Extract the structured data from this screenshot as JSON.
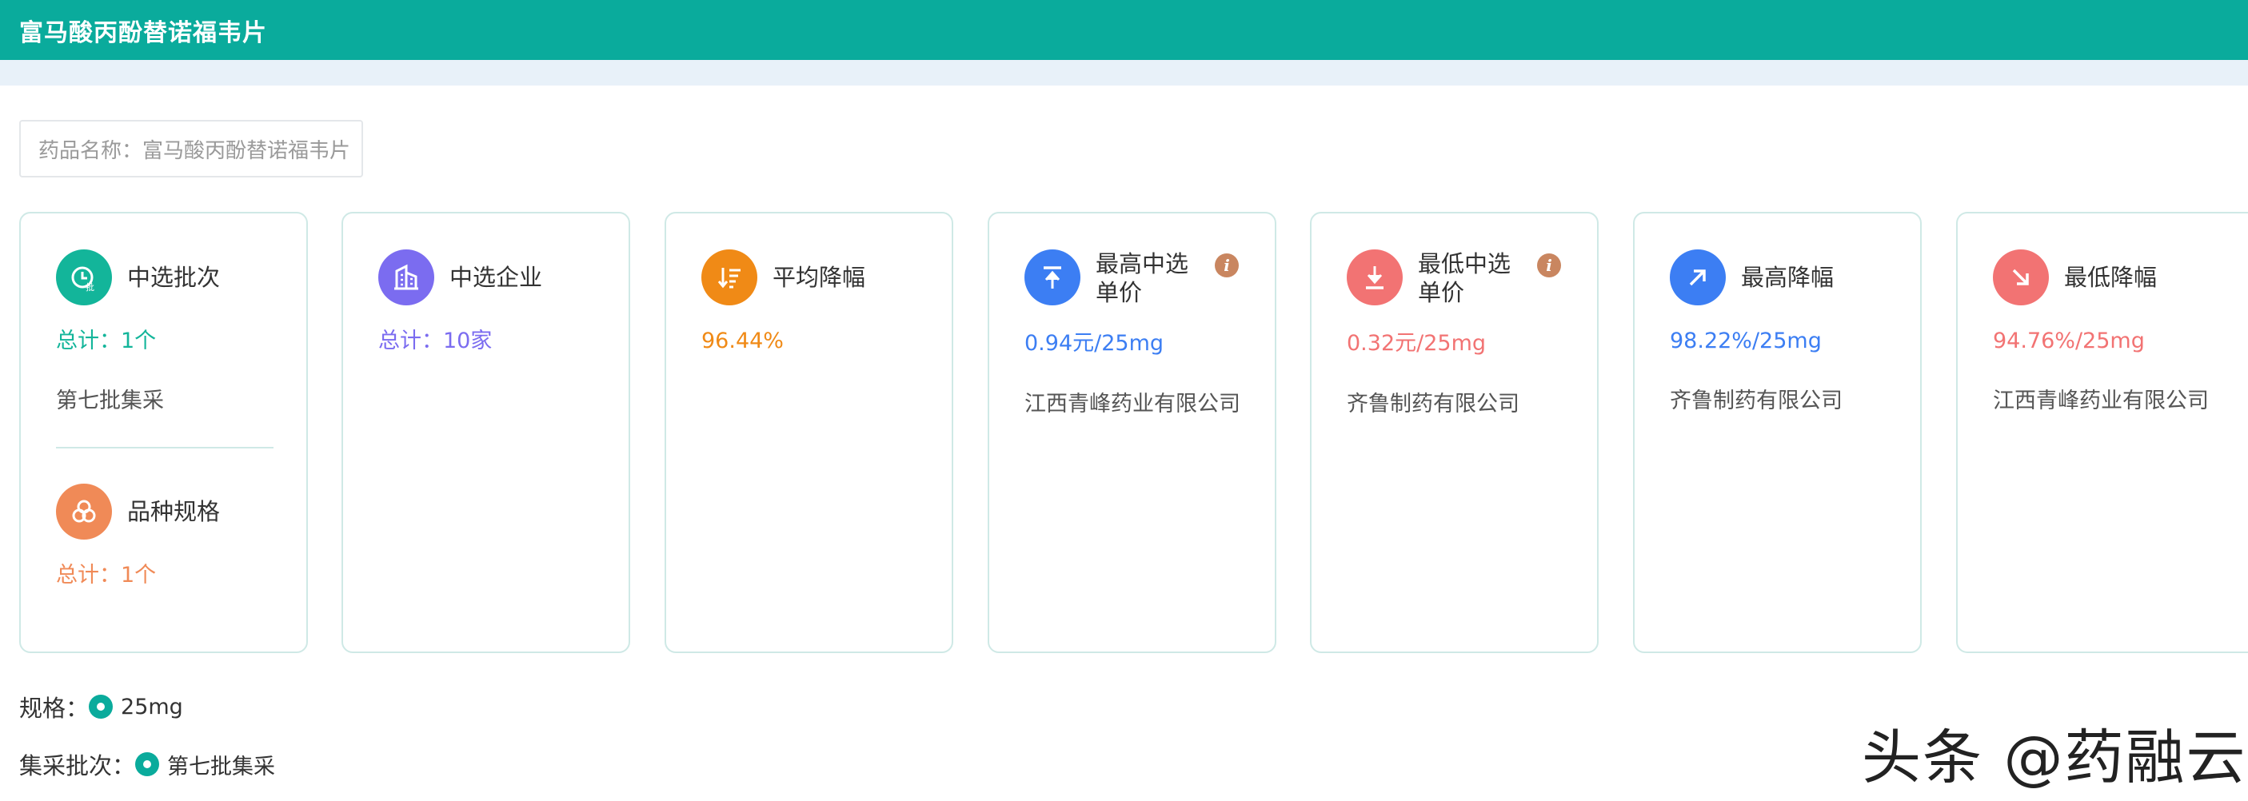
{
  "header": {
    "title": "富马酸丙酚替诺福韦片"
  },
  "search": {
    "label": "药品名称：",
    "value": "富马酸丙酚替诺福韦片"
  },
  "cards": {
    "batch": {
      "title": "中选批次",
      "total": "总计：1个",
      "detail": "第七批集采",
      "color": "#13b59a",
      "icon": "batch-icon"
    },
    "spec": {
      "title": "品种规格",
      "total": "总计：1个",
      "color": "#f08a57",
      "icon": "spec-icon"
    },
    "company": {
      "title": "中选企业",
      "total": "总计：10家",
      "color": "#7b6cf0",
      "icon": "building-icon"
    },
    "avg_drop": {
      "title": "平均降幅",
      "value": "96.44%",
      "color": "#f08a16",
      "icon": "sort-down-icon"
    },
    "max_price": {
      "title_line1": "最高中选",
      "title_line2": "单价",
      "value": "0.94元/25mg",
      "company": "江西青峰药业有限公司",
      "color": "#3c7ef3",
      "icon": "arrow-up-icon",
      "info": "i"
    },
    "min_price": {
      "title_line1": "最低中选",
      "title_line2": "单价",
      "value": "0.32元/25mg",
      "company": "齐鲁制药有限公司",
      "color": "#f27373",
      "icon": "arrow-down-icon",
      "info": "i"
    },
    "max_drop": {
      "title": "最高降幅",
      "value": "98.22%/25mg",
      "company": "齐鲁制药有限公司",
      "color": "#3c7ef3",
      "icon": "trend-up-icon"
    },
    "min_drop": {
      "title": "最低降幅",
      "value": "94.76%/25mg",
      "company": "江西青峰药业有限公司",
      "color": "#f27373",
      "icon": "trend-down-icon"
    }
  },
  "filters": {
    "spec": {
      "label": "规格：",
      "option": "25mg"
    },
    "batch": {
      "label": "集采批次：",
      "option": "第七批集采"
    }
  },
  "watermark": "头条 @药融云"
}
